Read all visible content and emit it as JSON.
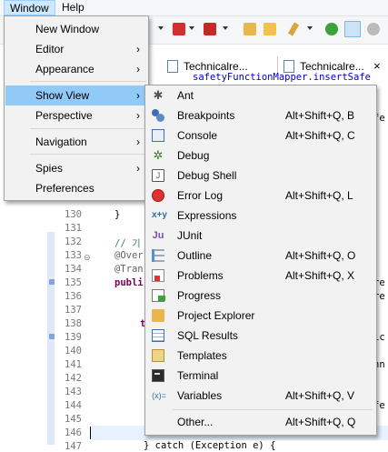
{
  "menubar": {
    "window": "Window",
    "help": "Help"
  },
  "tabs": [
    {
      "label": "Technicalre..."
    },
    {
      "label": "Technicalre..."
    }
  ],
  "tab_close": "×",
  "editor": {
    "top_code": "safetyFunctionMapper.insertSafe",
    "line_numbers": [
      "130",
      "131",
      "132",
      "133",
      "134",
      "135",
      "136",
      "137",
      "138",
      "139",
      "140",
      "141",
      "142",
      "143",
      "144",
      "145",
      "146",
      "147"
    ],
    "lines": {
      "l130": "}",
      "l132": "// 기",
      "l133": "@Over",
      "l134": "@Tran",
      "l135": "publi",
      "l138": "t"
    },
    "right_fragments": [
      "fe",
      "re",
      "re",
      "ic",
      "hn",
      "fe"
    ],
    "bottom_code": "} catch (Exception e) {"
  },
  "window_menu": {
    "items": [
      {
        "label": "New Window",
        "submenu": false
      },
      {
        "label": "Editor",
        "submenu": true
      },
      {
        "label": "Appearance",
        "submenu": true
      },
      {
        "label": "Show View",
        "submenu": true,
        "selected": true
      },
      {
        "label": "Perspective",
        "submenu": true
      },
      {
        "label": "Navigation",
        "submenu": true
      },
      {
        "label": "Spies",
        "submenu": true
      },
      {
        "label": "Preferences",
        "submenu": false
      }
    ],
    "arrow": "›"
  },
  "show_view_menu": {
    "items": [
      {
        "label": "Ant",
        "shortcut": "",
        "icon": "ant-icon"
      },
      {
        "label": "Breakpoints",
        "shortcut": "Alt+Shift+Q, B",
        "icon": "breakpoints-icon"
      },
      {
        "label": "Console",
        "shortcut": "Alt+Shift+Q, C",
        "icon": "console-icon"
      },
      {
        "label": "Debug",
        "shortcut": "",
        "icon": "debug-icon"
      },
      {
        "label": "Debug Shell",
        "shortcut": "",
        "icon": "debug-shell-icon"
      },
      {
        "label": "Error Log",
        "shortcut": "Alt+Shift+Q, L",
        "icon": "error-log-icon"
      },
      {
        "label": "Expressions",
        "shortcut": "",
        "icon": "expressions-icon"
      },
      {
        "label": "JUnit",
        "shortcut": "",
        "icon": "junit-icon"
      },
      {
        "label": "Outline",
        "shortcut": "Alt+Shift+Q, O",
        "icon": "outline-icon"
      },
      {
        "label": "Problems",
        "shortcut": "Alt+Shift+Q, X",
        "icon": "problems-icon"
      },
      {
        "label": "Progress",
        "shortcut": "",
        "icon": "progress-icon"
      },
      {
        "label": "Project Explorer",
        "shortcut": "",
        "icon": "project-explorer-icon"
      },
      {
        "label": "SQL Results",
        "shortcut": "",
        "icon": "sql-results-icon"
      },
      {
        "label": "Templates",
        "shortcut": "",
        "icon": "templates-icon"
      },
      {
        "label": "Terminal",
        "shortcut": "",
        "icon": "terminal-icon"
      },
      {
        "label": "Variables",
        "shortcut": "Alt+Shift+Q, V",
        "icon": "variables-icon"
      }
    ],
    "other": {
      "label": "Other...",
      "shortcut": "Alt+Shift+Q, Q"
    },
    "glyphs": {
      "ant": "✱",
      "debug": "✲",
      "debug_shell": "J",
      "expressions": "x+y",
      "junit": "Ju",
      "variables": "(x)="
    }
  },
  "colors": {
    "selection": "#91c9f7",
    "menu_bg": "#f2f2f2",
    "menubar_active": "#cde8ff"
  }
}
